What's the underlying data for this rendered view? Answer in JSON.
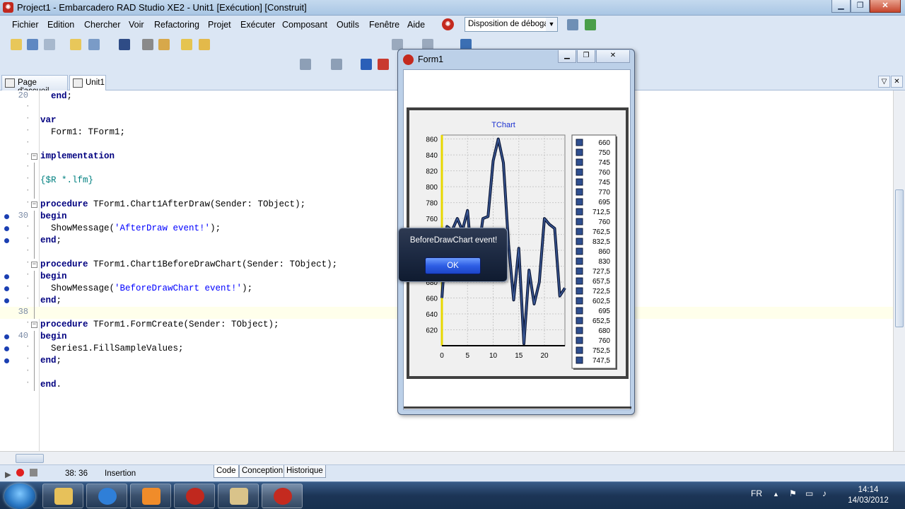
{
  "window": {
    "title": "Project1 - Embarcadero RAD Studio XE2 - Unit1 [Exécution] [Construit]"
  },
  "menu": [
    "Fichier",
    "Edition",
    "Chercher",
    "Voir",
    "Refactoring",
    "Projet",
    "Exécuter",
    "Composant",
    "Outils",
    "Fenêtre",
    "Aide"
  ],
  "layout_combo": {
    "value": "Disposition de débogage"
  },
  "tabs": [
    {
      "label": "Page d'accueil"
    },
    {
      "label": "Unit1"
    }
  ],
  "code_lines": [
    {
      "num": "20",
      "html": "  <span class='kw'>end</span>;"
    },
    {
      "num": "",
      "html": ""
    },
    {
      "num": "",
      "html": "<span class='kw'>var</span>"
    },
    {
      "num": "",
      "html": "  Form1: TForm1;"
    },
    {
      "num": "",
      "html": ""
    },
    {
      "num": "",
      "html": "<span class='kw'>implementation</span>"
    },
    {
      "num": "",
      "html": ""
    },
    {
      "num": "",
      "html": "<span class='dir'>{$R *.lfm}</span>"
    },
    {
      "num": "",
      "html": ""
    },
    {
      "num": "",
      "html": "<span class='kw'>procedure</span> TForm1.Chart1AfterDraw(Sender: TObject);"
    },
    {
      "num": "30",
      "html": "<span class='kw'>begin</span>"
    },
    {
      "num": "",
      "html": "  ShowMessage(<span class='str'>'AfterDraw event!'</span>);"
    },
    {
      "num": "",
      "html": "<span class='kw'>end</span>;"
    },
    {
      "num": "",
      "html": ""
    },
    {
      "num": "",
      "html": "<span class='kw'>procedure</span> TForm1.Chart1BeforeDrawChart(Sender: TObject);"
    },
    {
      "num": "",
      "html": "<span class='kw'>begin</span>"
    },
    {
      "num": "",
      "html": "  ShowMessage(<span class='str'>'BeforeDrawChart event!'</span>);"
    },
    {
      "num": "",
      "html": "<span class='kw'>end</span>;"
    },
    {
      "num": "38",
      "html": ""
    },
    {
      "num": "",
      "html": "<span class='kw'>procedure</span> TForm1.FormCreate(Sender: TObject);"
    },
    {
      "num": "40",
      "html": "<span class='kw'>begin</span>"
    },
    {
      "num": "",
      "html": "  Series1.FillSampleValues;"
    },
    {
      "num": "",
      "html": "<span class='kw'>end</span>;"
    },
    {
      "num": "",
      "html": ""
    },
    {
      "num": "",
      "html": "<span class='kw'>end</span>."
    }
  ],
  "status": {
    "position": "38: 36",
    "mode": "Insertion",
    "tabs": [
      "Code",
      "Conception",
      "Historique"
    ]
  },
  "form1": {
    "title": "Form1"
  },
  "chart_data": {
    "type": "line",
    "title": "TChart",
    "x": [
      0,
      1,
      2,
      3,
      4,
      5,
      6,
      7,
      8,
      9,
      10,
      11,
      12,
      13,
      14,
      15,
      16,
      17,
      18,
      19,
      20,
      21,
      22,
      23,
      24
    ],
    "series": [
      {
        "name": "",
        "values": [
          660,
          750,
          745,
          760,
          745,
          770,
          695,
          712.5,
          760,
          762.5,
          832.5,
          860,
          830,
          727.5,
          657.5,
          722.5,
          602.5,
          695,
          652.5,
          680,
          760,
          752.5,
          747.5,
          662.5,
          672.5
        ]
      }
    ],
    "xticks": [
      "0",
      "5",
      "10",
      "15",
      "20"
    ],
    "yticks": [
      "620",
      "640",
      "660",
      "680",
      "700",
      "720",
      "740",
      "760",
      "780",
      "800",
      "820",
      "840",
      "860"
    ],
    "legend": [
      "660",
      "750",
      "745",
      "760",
      "745",
      "770",
      "695",
      "712,5",
      "760",
      "762,5",
      "832,5",
      "860",
      "830",
      "727,5",
      "657,5",
      "722,5",
      "602,5",
      "695",
      "652,5",
      "680",
      "760",
      "752,5",
      "747,5"
    ],
    "ylim": [
      600,
      865
    ],
    "xlim": [
      0,
      24
    ],
    "legend_position": "right",
    "grid": true
  },
  "dialog": {
    "message": "BeforeDrawChart event!",
    "ok_label": "OK"
  },
  "tray": {
    "lang": "FR",
    "time": "14:14",
    "date": "14/03/2012"
  }
}
